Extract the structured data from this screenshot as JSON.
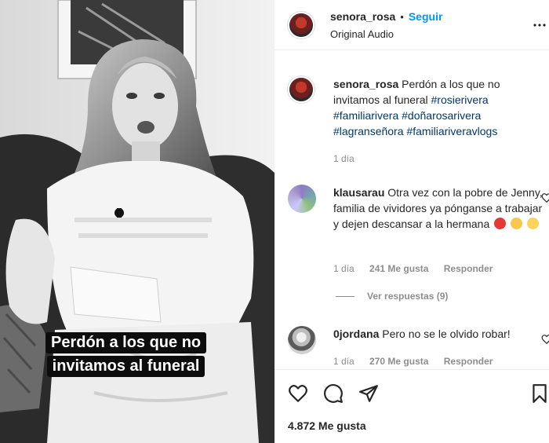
{
  "post": {
    "username": "senora_rosa",
    "follow_label": "Seguir",
    "separator": "•",
    "audio_label": "Original Audio",
    "video_caption_lines": [
      "Perdón a los que no",
      "invitamos al funeral"
    ]
  },
  "caption": {
    "username": "senora_rosa",
    "text": "Perdón a los que no invitamos al funeral",
    "hashtags": [
      "#rosierivera",
      "#familiarivera",
      "#doñarosarivera",
      "#lagranseñora",
      "#familiariveravlogs"
    ],
    "time": "1 día"
  },
  "comments": [
    {
      "username": "klausarau",
      "text": "Otra vez con la pobre de Jenny, familia de vividores ya pónganse a trabajar y dejen descansar a la hermana",
      "emojis": [
        "angry-face-icon",
        "disappointed-face-icon",
        "eye-roll-face-icon"
      ],
      "time": "1 día",
      "likes": "241 Me gusta",
      "reply_label": "Responder",
      "view_replies": "Ver respuestas (9)"
    },
    {
      "username": "0jordana",
      "text": "Pero no se le olvido robar!",
      "time": "1 día",
      "likes": "270 Me gusta",
      "reply_label": "Responder"
    }
  ],
  "actions": {
    "icons": [
      "heart-icon",
      "comment-icon",
      "share-icon",
      "bookmark-icon"
    ],
    "likes_count": "4.872 Me gusta"
  }
}
